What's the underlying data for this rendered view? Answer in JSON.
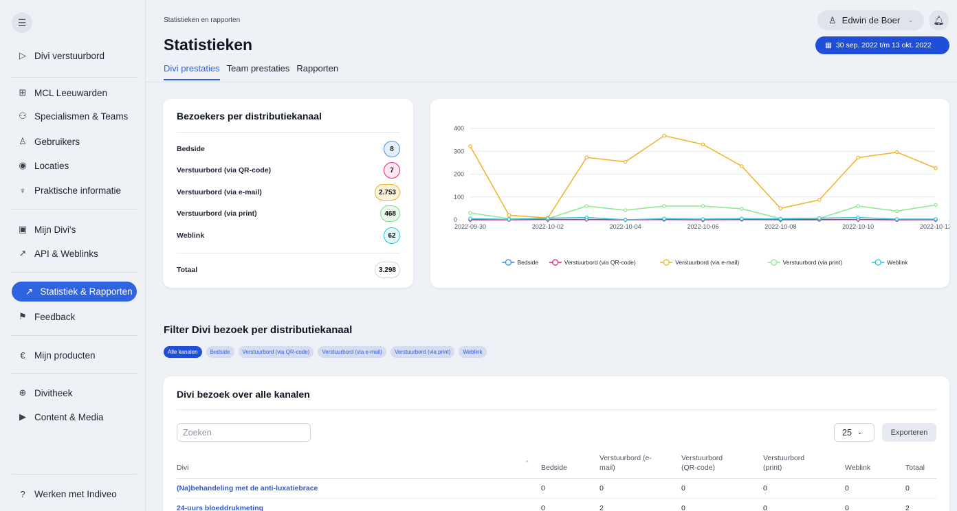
{
  "sidebar": {
    "menu_icon": "menu-icon",
    "items": [
      {
        "label": "Divi verstuurbord",
        "icon": "send-icon"
      },
      {
        "label": "MCL Leeuwarden",
        "icon": "hospital-icon"
      },
      {
        "label": "Specialismen & Teams",
        "icon": "team-icon"
      },
      {
        "label": "Gebruikers",
        "icon": "user-icon"
      },
      {
        "label": "Locaties",
        "icon": "location-icon"
      },
      {
        "label": "Praktische informatie",
        "icon": "info-icon"
      },
      {
        "label": "Mijn Divi's",
        "icon": "divi-icon"
      },
      {
        "label": "API & Weblinks",
        "icon": "link-icon"
      },
      {
        "label": "Statistiek & Rapporten",
        "icon": "chart-icon"
      },
      {
        "label": "Feedback",
        "icon": "megaphone-icon"
      },
      {
        "label": "Mijn producten",
        "icon": "euro-icon"
      },
      {
        "label": "Divitheek",
        "icon": "library-icon"
      },
      {
        "label": "Content & Media",
        "icon": "play-icon"
      },
      {
        "label": "Werken met Indiveo",
        "icon": "help-icon"
      }
    ]
  },
  "header": {
    "breadcrumb": "Statistieken en rapporten",
    "title": "Statistieken",
    "tabs": [
      "Divi prestaties",
      "Team prestaties",
      "Rapporten"
    ],
    "user": "Edwin de Boer",
    "date_range": "30 sep. 2022 t/m 13 okt. 2022"
  },
  "visitors": {
    "title": "Bezoekers per distributiekanaal",
    "rows": [
      {
        "label": "Bedside",
        "value": "8",
        "color": "#4a90e2",
        "bg": "#e6f0fc"
      },
      {
        "label": "Verstuurbord (via QR-code)",
        "value": "7",
        "color": "#e0287a",
        "bg": "#fde6f0"
      },
      {
        "label": "Verstuurbord (via e-mail)",
        "value": "2.753",
        "color": "#f0b323",
        "bg": "#fdf3d9"
      },
      {
        "label": "Verstuurbord (via print)",
        "value": "468",
        "color": "#7ee08a",
        "bg": "#e8f9ea"
      },
      {
        "label": "Weblink",
        "value": "62",
        "color": "#29c4d8",
        "bg": "#e2f7fa"
      }
    ],
    "total_label": "Totaal",
    "total_value": "3.298"
  },
  "chart_data": {
    "type": "line",
    "x": [
      "2022-09-30",
      "2022-10-01",
      "2022-10-02",
      "2022-10-03",
      "2022-10-04",
      "2022-10-05",
      "2022-10-06",
      "2022-10-07",
      "2022-10-08",
      "2022-10-09",
      "2022-10-10",
      "2022-10-11",
      "2022-10-12"
    ],
    "x_tick_labels": [
      "2022-09-30",
      "2022-10-02",
      "2022-10-04",
      "2022-10-06",
      "2022-10-08",
      "2022-10-10",
      "2022-10-12"
    ],
    "y_ticks": [
      "0",
      "100",
      "200",
      "300",
      "400"
    ],
    "ylim": [
      0,
      400
    ],
    "legend_position": "bottom",
    "series": [
      {
        "name": "Bedside",
        "color": "#2b8fe8",
        "values": [
          2,
          1,
          1,
          1,
          0,
          1,
          1,
          1,
          0,
          0,
          1,
          0,
          0
        ]
      },
      {
        "name": "Verstuurbord (via QR-code)",
        "color": "#d8237a",
        "values": [
          0,
          0,
          1,
          1,
          0,
          1,
          0,
          1,
          1,
          1,
          1,
          0,
          1
        ]
      },
      {
        "name": "Verstuurbord (via e-mail)",
        "color": "#f0b323",
        "values": [
          322,
          20,
          8,
          273,
          254,
          368,
          330,
          235,
          50,
          87,
          272,
          296,
          226
        ]
      },
      {
        "name": "Verstuurbord (via print)",
        "color": "#8ae88f",
        "values": [
          30,
          5,
          5,
          60,
          42,
          60,
          60,
          48,
          5,
          6,
          60,
          38,
          65
        ]
      },
      {
        "name": "Weblink",
        "color": "#29c4d8",
        "values": [
          5,
          2,
          7,
          10,
          0,
          5,
          3,
          5,
          4,
          7,
          10,
          3,
          3
        ]
      }
    ]
  },
  "filter": {
    "title": "Filter Divi bezoek per distributiekanaal",
    "chips": [
      "Alle kanalen",
      "Bedside",
      "Verstuurbord (via QR-code)",
      "Verstuurbord (via e-mail)",
      "Verstuurbord (via print)",
      "Weblink"
    ]
  },
  "table": {
    "title": "Divi bezoek over alle kanalen",
    "search_placeholder": "Zoeken",
    "page_size": "25",
    "export_label": "Exporteren",
    "columns": [
      "Divi",
      "Bedside",
      "Verstuurbord (e-\nmail)",
      "Verstuurbord\n(QR-code)",
      "Verstuurbord\n(print)",
      "Weblink",
      "Totaal"
    ],
    "rows": [
      [
        "(Na)behandeling met de anti-luxatiebrace",
        "0",
        "0",
        "0",
        "0",
        "0",
        "0"
      ],
      [
        "24-uurs bloeddrukmeting",
        "0",
        "2",
        "0",
        "0",
        "0",
        "2"
      ]
    ]
  }
}
